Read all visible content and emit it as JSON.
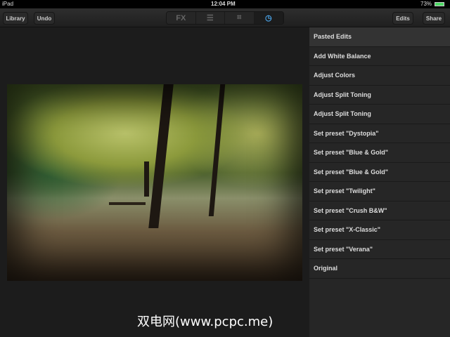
{
  "status": {
    "device": "iPad",
    "time": "12:04 PM",
    "battery": "73%"
  },
  "toolbar": {
    "library": "Library",
    "undo": "Undo",
    "edits": "Edits",
    "share": "Share",
    "fx": "FX"
  },
  "history": [
    "Pasted Edits",
    "Add White Balance",
    "Adjust Colors",
    "Adjust Split Toning",
    "Adjust Split Toning",
    "Set preset \"Dystopia\"",
    "Set preset \"Blue & Gold\"",
    "Set preset \"Blue & Gold\"",
    "Set preset \"Twilight\"",
    "Set preset \"Crush B&W\"",
    "Set preset \"X-Classic\"",
    "Set preset \"Verana\"",
    "Original"
  ],
  "watermark": "双电网(www.pcpc.me)",
  "colors": {
    "accent": "#4aa3e8"
  }
}
